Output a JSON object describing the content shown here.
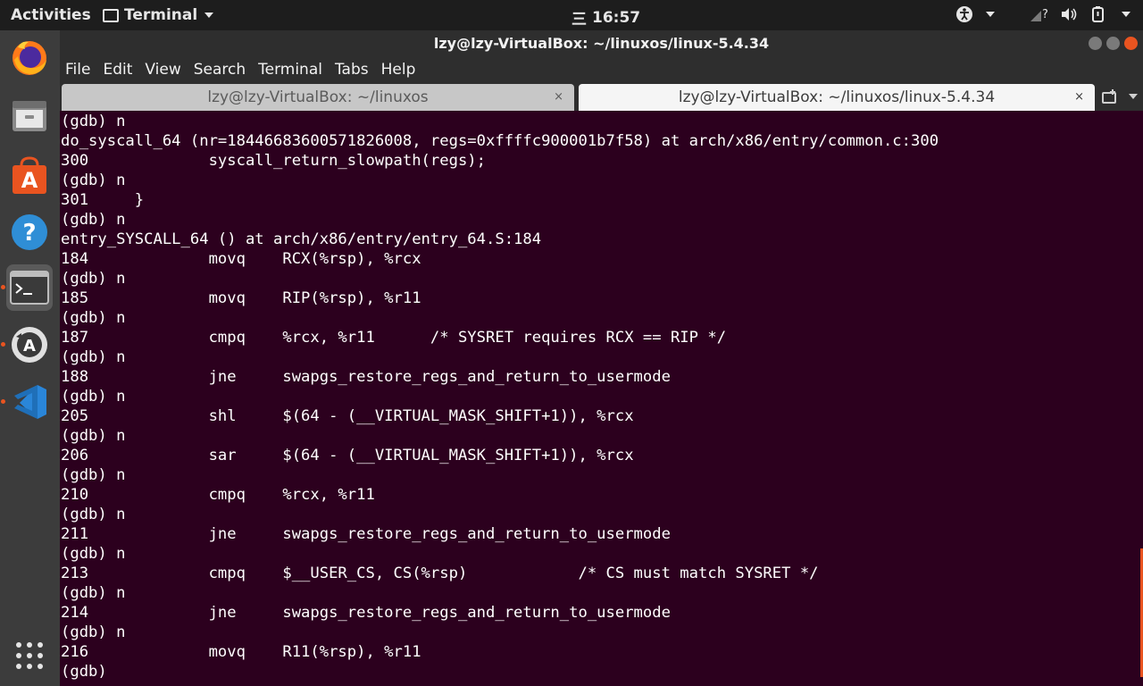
{
  "topbar": {
    "activities": "Activities",
    "app_name": "Terminal",
    "clock": "16:57",
    "clock_prefix": "三"
  },
  "dock": {
    "items": [
      {
        "name": "firefox"
      },
      {
        "name": "files"
      },
      {
        "name": "software"
      },
      {
        "name": "help"
      },
      {
        "name": "terminal"
      },
      {
        "name": "software-updater"
      },
      {
        "name": "vscode"
      }
    ]
  },
  "window": {
    "title": "lzy@lzy-VirtualBox: ~/linuxos/linux-5.4.34",
    "menu": [
      "File",
      "Edit",
      "View",
      "Search",
      "Terminal",
      "Tabs",
      "Help"
    ],
    "tabs": [
      {
        "label": "lzy@lzy-VirtualBox: ~/linuxos",
        "close": "×"
      },
      {
        "label": "lzy@lzy-VirtualBox: ~/linuxos/linux-5.4.34",
        "close": "×"
      }
    ]
  },
  "terminal": {
    "lines": [
      "(gdb) n",
      "do_syscall_64 (nr=18446683600571826008, regs=0xffffc900001b7f58) at arch/x86/entry/common.c:300",
      "300             syscall_return_slowpath(regs);",
      "(gdb) n",
      "301     }",
      "(gdb) n",
      "entry_SYSCALL_64 () at arch/x86/entry/entry_64.S:184",
      "184             movq    RCX(%rsp), %rcx",
      "(gdb) n",
      "185             movq    RIP(%rsp), %r11",
      "(gdb) n",
      "187             cmpq    %rcx, %r11      /* SYSRET requires RCX == RIP */",
      "(gdb) n",
      "188             jne     swapgs_restore_regs_and_return_to_usermode",
      "(gdb) n",
      "205             shl     $(64 - (__VIRTUAL_MASK_SHIFT+1)), %rcx",
      "(gdb) n",
      "206             sar     $(64 - (__VIRTUAL_MASK_SHIFT+1)), %rcx",
      "(gdb) n",
      "210             cmpq    %rcx, %r11",
      "(gdb) n",
      "211             jne     swapgs_restore_regs_and_return_to_usermode",
      "(gdb) n",
      "213             cmpq    $__USER_CS, CS(%rsp)            /* CS must match SYSRET */",
      "(gdb) n",
      "214             jne     swapgs_restore_regs_and_return_to_usermode",
      "(gdb) n",
      "216             movq    R11(%rsp), %r11",
      "(gdb) "
    ]
  },
  "colors": {
    "terminal_bg": "#2c001e",
    "accent": "#e95420",
    "dock_bg": "#3c3c3c",
    "topbar_bg": "#1d1d1d"
  }
}
